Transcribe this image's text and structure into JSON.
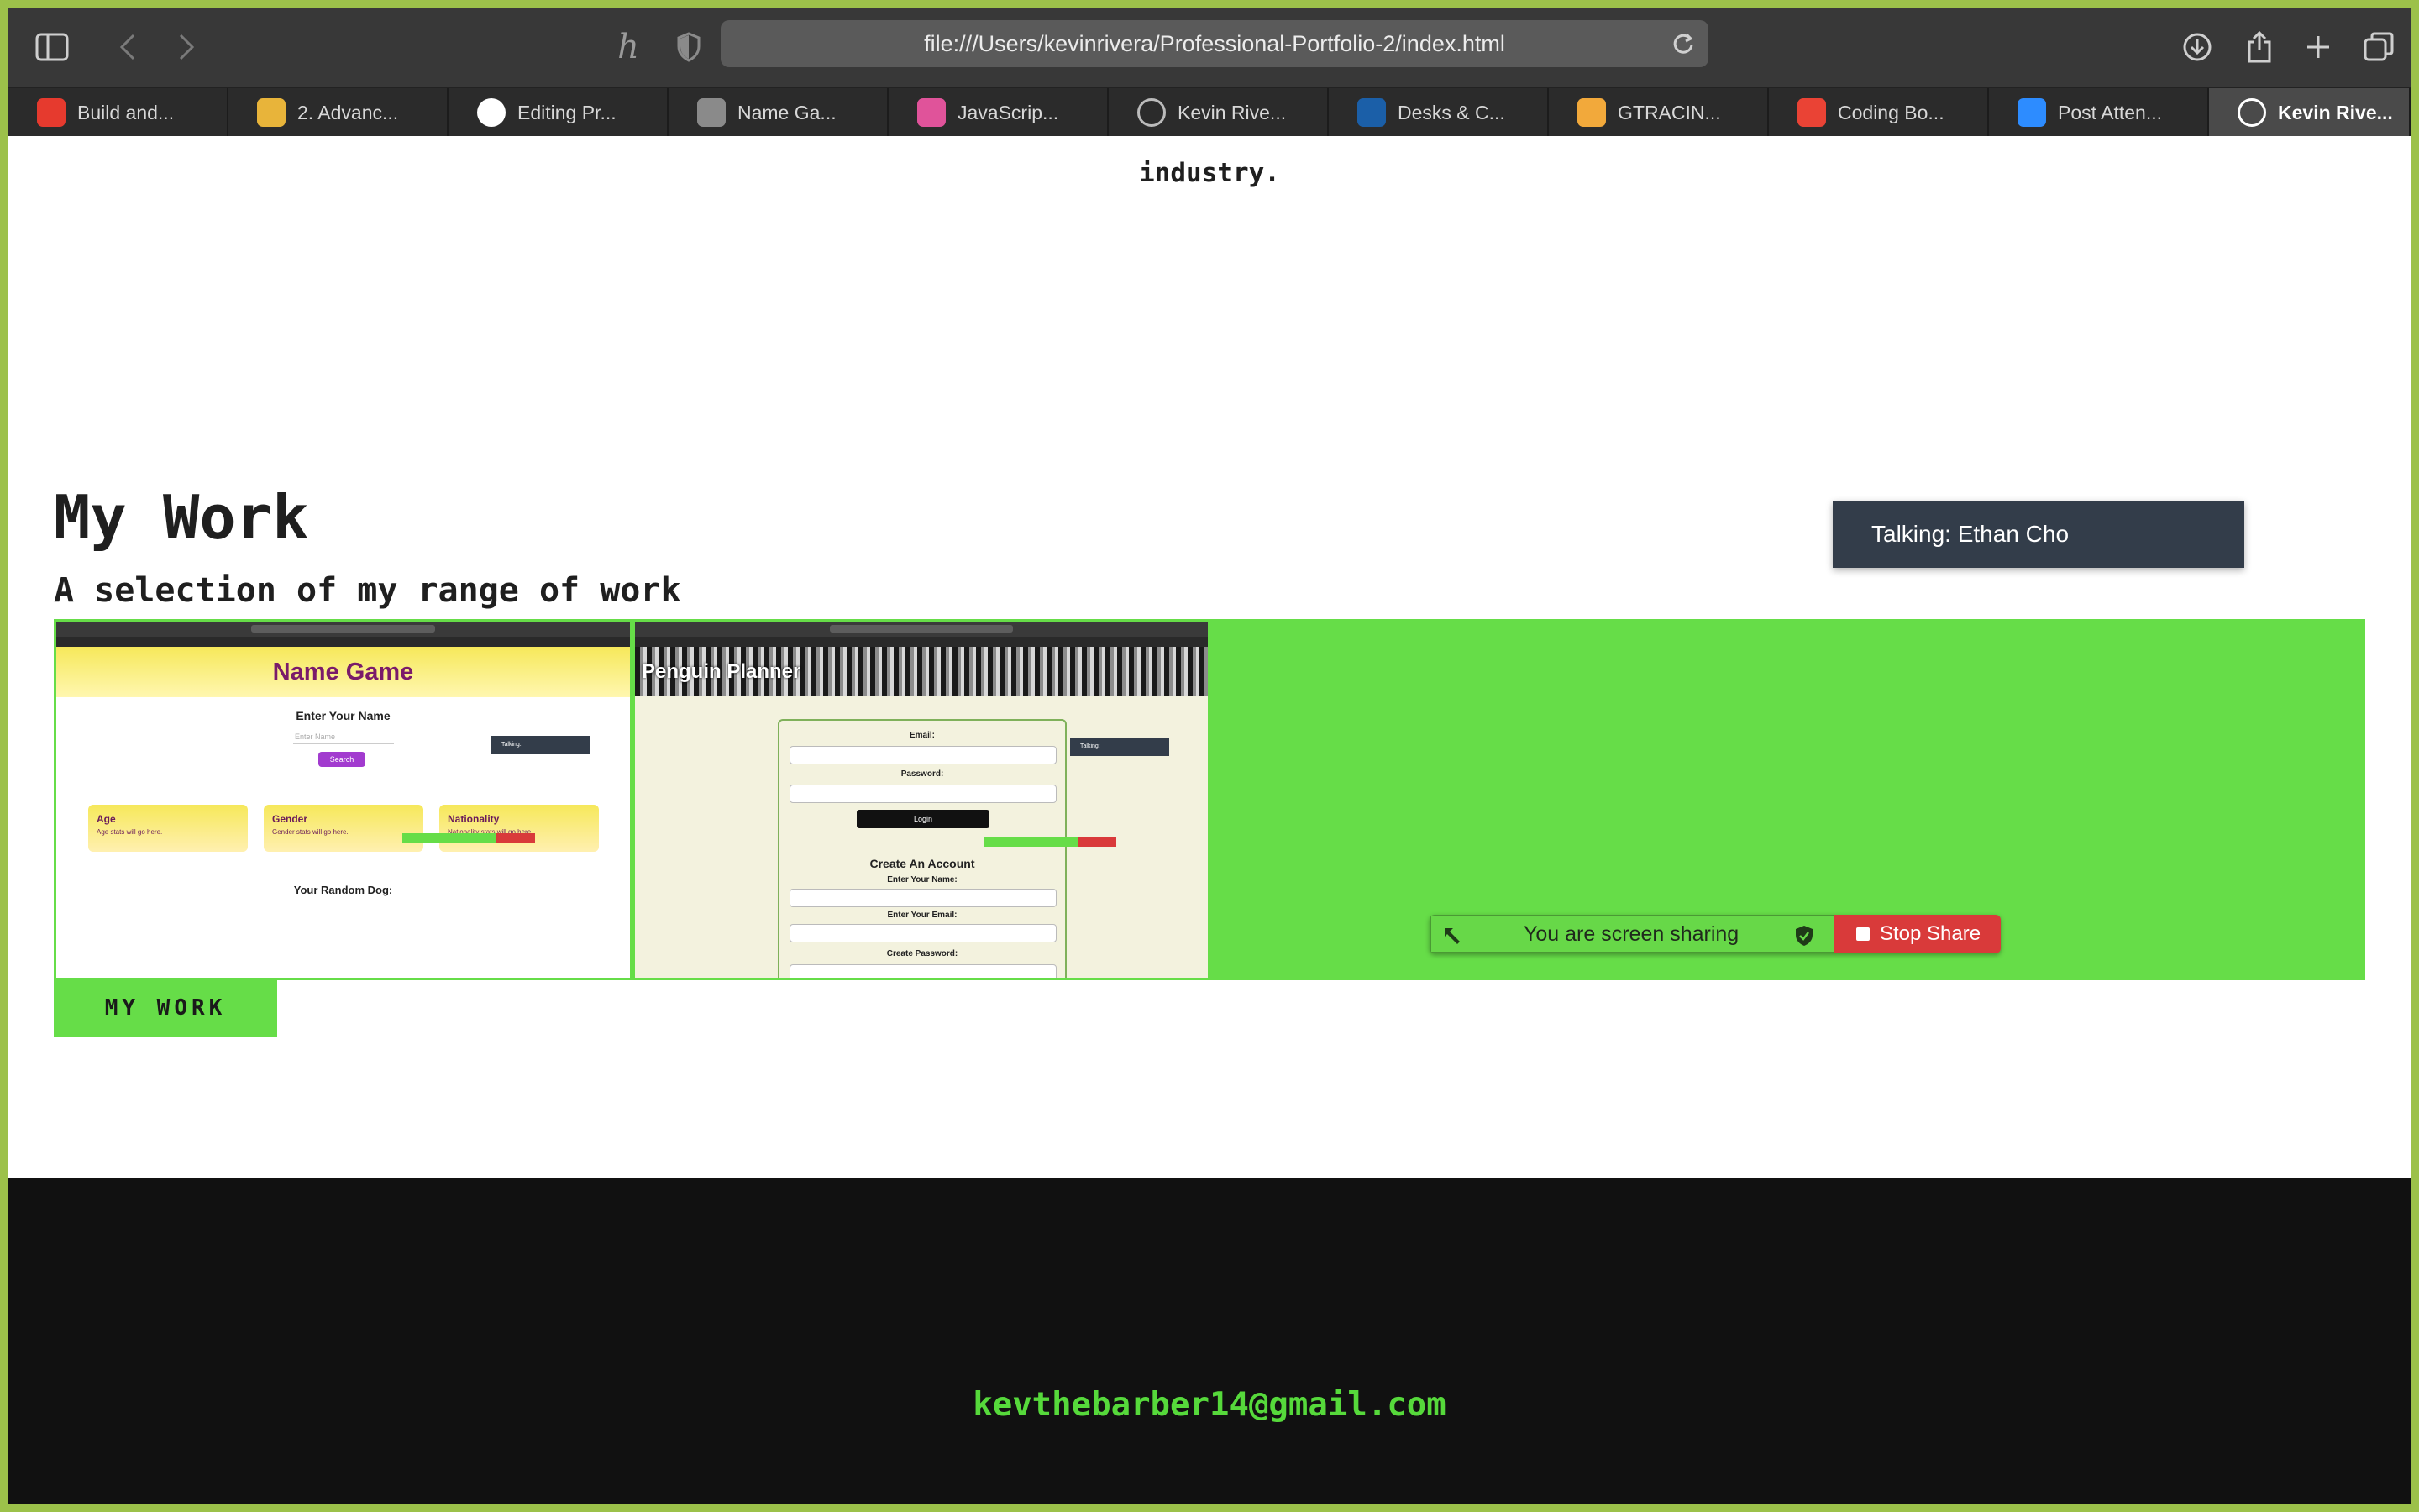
{
  "browser": {
    "url": "file:///Users/kevinrivera/Professional-Portfolio-2/index.html",
    "tabs": [
      {
        "label": "Build and...",
        "icon": "youtube-icon",
        "color": "#e63a2e"
      },
      {
        "label": "2. Advanc...",
        "icon": "coding-course-icon",
        "color": "#e8b43a"
      },
      {
        "label": "Editing Pr...",
        "icon": "github-icon",
        "color": "#ffffff"
      },
      {
        "label": "Name Ga...",
        "icon": "letter-c-icon",
        "color": "#8a8a8a"
      },
      {
        "label": "JavaScrip...",
        "icon": "play-icon",
        "color": "#e0539a"
      },
      {
        "label": "Kevin Rive...",
        "icon": "compass-icon",
        "color": "#bbbbbb"
      },
      {
        "label": "Desks & C...",
        "icon": "ikea-icon",
        "color": "#1b5fa8"
      },
      {
        "label": "GTRACIN...",
        "icon": "spark-icon",
        "color": "#f2a93b"
      },
      {
        "label": "Coding Bo...",
        "icon": "gmail-icon",
        "color": "#ea4335"
      },
      {
        "label": "Post Atten...",
        "icon": "zoom-icon",
        "color": "#2d8cff"
      },
      {
        "label": "Kevin Rive...",
        "icon": "compass-icon",
        "color": "#ffffff",
        "active": true
      }
    ]
  },
  "page": {
    "industry_text": "industry.",
    "work_heading": "My Work",
    "work_subheading": "A selection of my range of work",
    "my_work_button": "MY WORK",
    "accent_color": "#66dd48"
  },
  "projects": {
    "name_game": {
      "title": "Name Game",
      "enter_label": "Enter Your Name",
      "input_placeholder": "Enter Name",
      "search_label": "Search",
      "talking_label": "Talking:",
      "cards": [
        {
          "title": "Age",
          "text": "Age stats will go here."
        },
        {
          "title": "Gender",
          "text": "Gender stats will go here."
        },
        {
          "title": "Nationality",
          "text": "Nationality stats will go here."
        }
      ],
      "dog_label": "Your Random Dog:"
    },
    "penguin_planner": {
      "title": "Penguin Planner",
      "email_label": "Email:",
      "password_label": "Password:",
      "login_label": "Login",
      "create_heading": "Create An Account",
      "name_label": "Enter Your Name:",
      "email2_label": "Enter Your Email:",
      "create_password_label": "Create Password:",
      "talking_label": "Talking:"
    }
  },
  "overlay": {
    "talking": "Talking: Ethan Cho",
    "screen_sharing": "You are screen sharing",
    "stop_share": "Stop Share"
  },
  "footer": {
    "email": "kevthebarber14@gmail.com",
    "icons": [
      "github-icon",
      "javascript-icon"
    ],
    "icon_color": "#56d93b"
  }
}
